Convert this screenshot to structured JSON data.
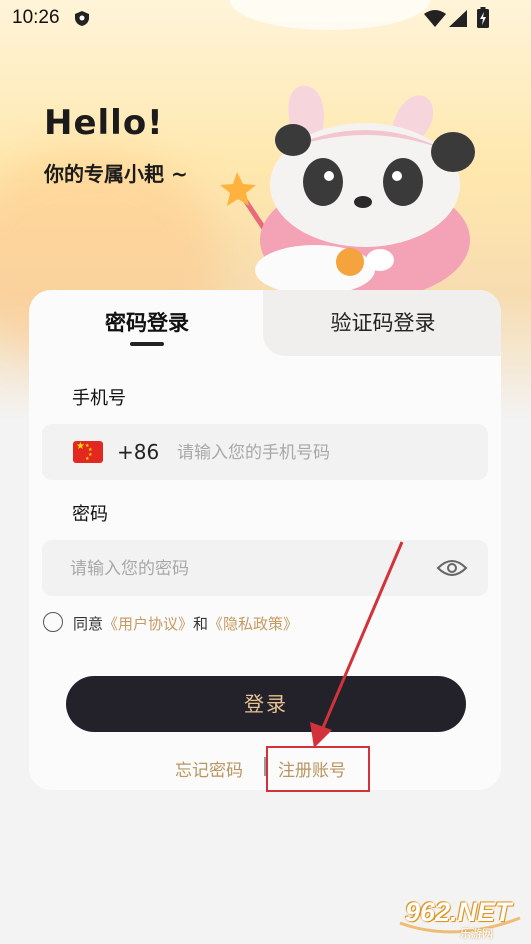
{
  "status_bar": {
    "time": "10:26",
    "icons": [
      "shield-icon",
      "wifi-icon",
      "signal-icon",
      "battery-charging-icon"
    ]
  },
  "greeting": {
    "title": "Hello!",
    "subtitle": "你的专属小耙 ~"
  },
  "tabs": [
    {
      "label": "密码登录",
      "active": true
    },
    {
      "label": "验证码登录",
      "active": false
    }
  ],
  "form": {
    "phone_label": "手机号",
    "country_code": "+86",
    "flag_icon": "china-flag-icon",
    "phone_placeholder": "请输入您的手机号码",
    "phone_value": "",
    "password_label": "密码",
    "password_placeholder": "请输入您的密码",
    "password_value": ""
  },
  "agreement": {
    "checked": false,
    "prefix": "同意",
    "user_agreement": "《用户协议》",
    "and": "和",
    "privacy_policy": "《隐私政策》"
  },
  "actions": {
    "login_label": "登录",
    "forgot_password": "忘记密码",
    "register": "注册账号"
  },
  "watermark": {
    "logo_text": "962.NET",
    "sub_text": "乐游网"
  },
  "colors": {
    "accent_gold": "#c79a62",
    "button_dark": "#23222a",
    "annotation_red": "#d2323a"
  }
}
